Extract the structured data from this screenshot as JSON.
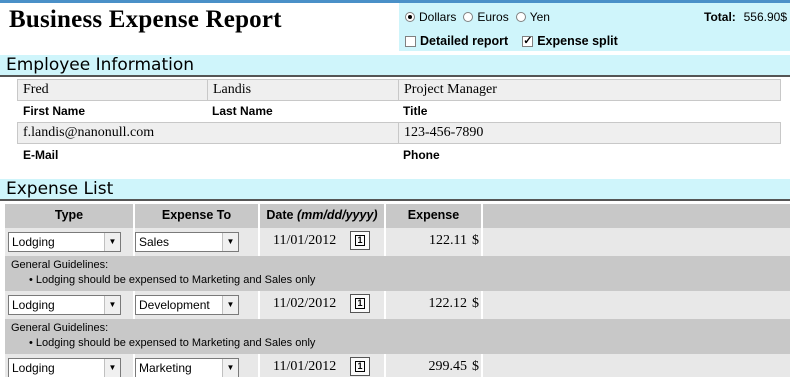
{
  "title": "Business Expense Report",
  "currency_options": [
    {
      "label": "Dollars",
      "checked": true
    },
    {
      "label": "Euros",
      "checked": false
    },
    {
      "label": "Yen",
      "checked": false
    }
  ],
  "total": {
    "label": "Total:",
    "value": "556.90$"
  },
  "report_options": [
    {
      "label": "Detailed report",
      "checked": false
    },
    {
      "label": "Expense split",
      "checked": true
    }
  ],
  "employee": {
    "section_title": "Employee Information",
    "first_name": {
      "label": "First Name",
      "value": "Fred"
    },
    "last_name": {
      "label": "Last Name",
      "value": "Landis"
    },
    "title": {
      "label": "Title",
      "value": "Project Manager"
    },
    "email": {
      "label": "E-Mail",
      "value": "f.landis@nanonull.com"
    },
    "phone": {
      "label": "Phone",
      "value": "123-456-7890"
    }
  },
  "expense_list": {
    "section_title": "Expense List",
    "columns": {
      "type": "Type",
      "expense_to": "Expense To",
      "date": "Date",
      "date_format": "(mm/dd/yyyy)",
      "expense": "Expense"
    },
    "rows": [
      {
        "type": "Lodging",
        "expense_to": "Sales",
        "date": "11/01/2012",
        "amount": "122.11",
        "currency": "$",
        "guide_title": "General Guidelines:",
        "guide_item": "Lodging should be expensed to Marketing and Sales only"
      },
      {
        "type": "Lodging",
        "expense_to": "Development",
        "date": "11/02/2012",
        "amount": "122.12",
        "currency": "$",
        "guide_title": "General Guidelines:",
        "guide_item": "Lodging should be expensed to Marketing and Sales only"
      },
      {
        "type": "Lodging",
        "expense_to": "Marketing",
        "date": "11/01/2012",
        "amount": "299.45",
        "currency": "$"
      }
    ],
    "calendar_glyph": "1"
  },
  "colors": {
    "panel_bg": "#cff5fb",
    "row_bg": "#e8e8e8",
    "header_bg": "#c8c8c8",
    "accent_rule": "#4a90c8"
  }
}
